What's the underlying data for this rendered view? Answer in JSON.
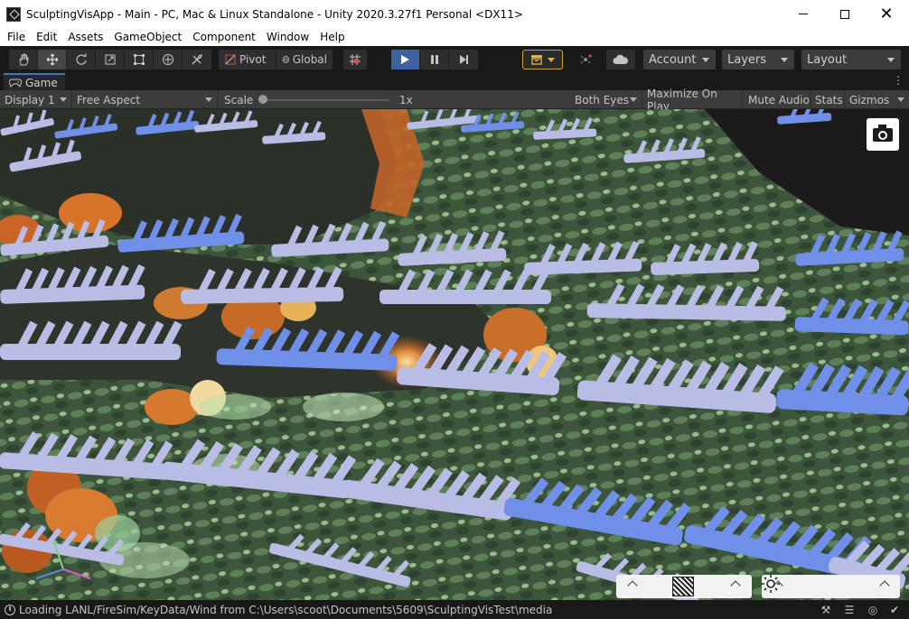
{
  "window": {
    "title": "SculptingVisApp - Main - PC, Mac & Linux Standalone - Unity 2020.3.27f1 Personal <DX11>",
    "minimize_glyph": "",
    "maximize_glyph": "",
    "close_glyph": "✕"
  },
  "menu": [
    "File",
    "Edit",
    "Assets",
    "GameObject",
    "Component",
    "Window",
    "Help"
  ],
  "toolbar": {
    "tools": [
      "hand-tool-icon",
      "move-tool-icon",
      "rotate-tool-icon",
      "scale-tool-icon",
      "rect-tool-icon",
      "transform-tool-icon",
      "custom-tool-icon"
    ],
    "pivot_label": "Pivot",
    "global_label": "Global",
    "account_label": "Account",
    "layers_label": "Layers",
    "layout_label": "Layout"
  },
  "game_view": {
    "tab_label": "Game",
    "display": "Display 1",
    "aspect": "Free Aspect",
    "scale_label": "Scale",
    "scale_value": "1x",
    "both_eyes": "Both Eyes",
    "maximize_on_play": "Maximize On Play",
    "mute_audio": "Mute Audio",
    "stats": "Stats",
    "gizmos": "Gizmos"
  },
  "status": {
    "message": "Loading LANL/FireSim/KeyData/Wind from C:\\Users\\scoot\\Documents\\5609\\SculptingVisTest\\media"
  },
  "colors": {
    "accent_blue": "#3d62a0",
    "collab_gold": "#e2b13c",
    "terrain_green": "#4d6a45",
    "fire_orange": "#d8742a",
    "glyph_lavender": "#b9bde6",
    "glyph_blue": "#6f8fe8"
  }
}
